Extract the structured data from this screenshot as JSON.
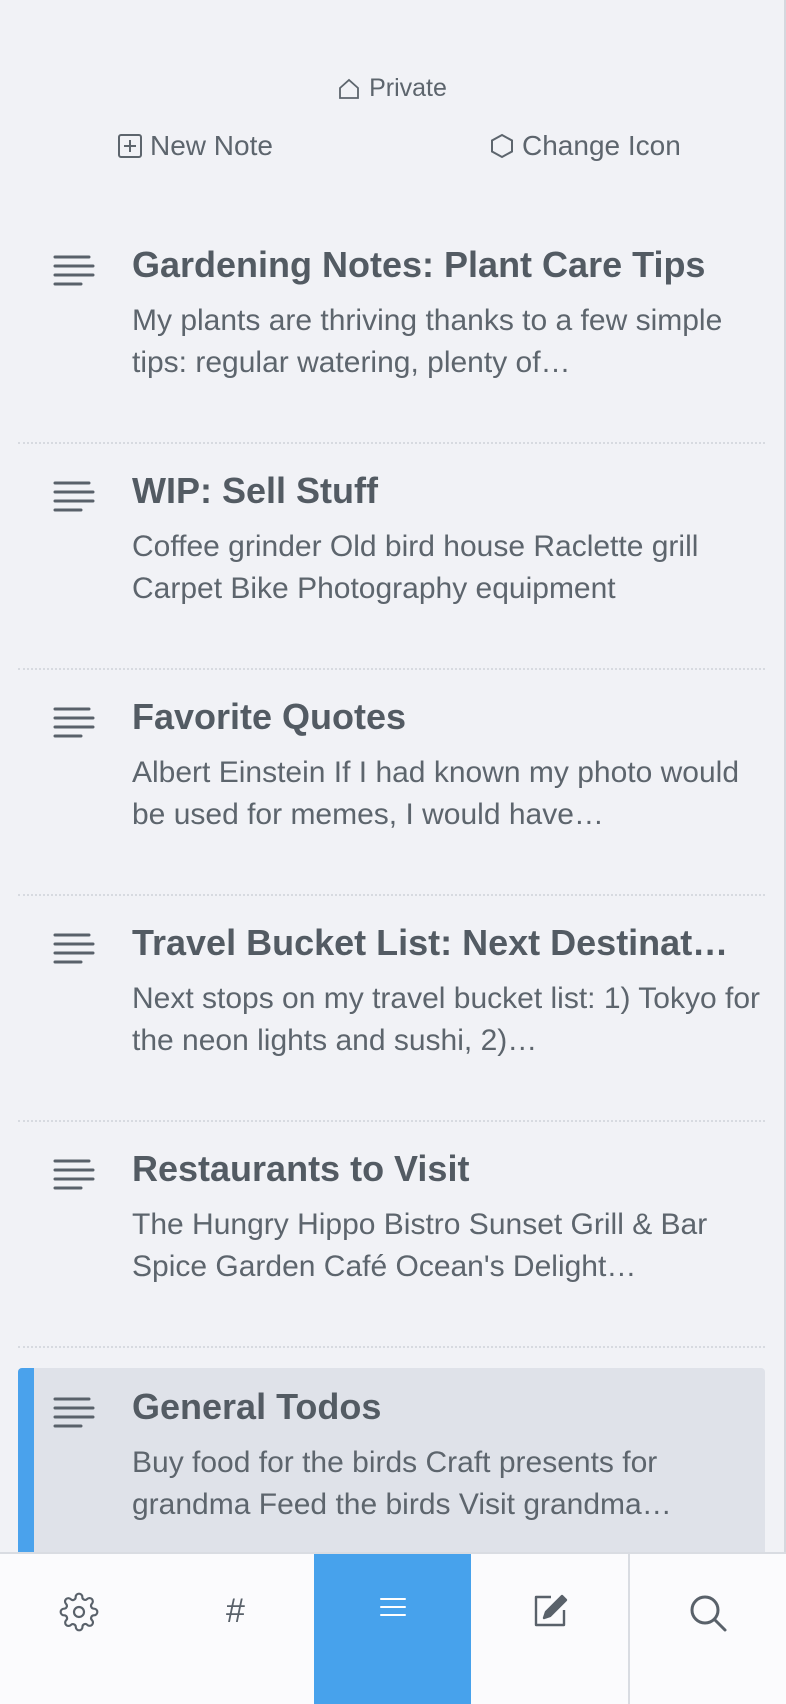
{
  "header": {
    "location_label": "Private",
    "location_icon": "home-icon",
    "new_note_label": "New Note",
    "new_note_icon": "plus-square-icon",
    "change_icon_label": "Change Icon",
    "change_icon_icon": "hexagon-icon"
  },
  "notes": [
    {
      "title": "Gardening Notes: Plant Care Tips",
      "preview": "My plants are thriving thanks to a few simple tips: regular watering, plenty of…"
    },
    {
      "title": "WIP: Sell Stuff",
      "preview": "Coffee grinder Old bird house Raclette grill Carpet Bike Photography equipment"
    },
    {
      "title": "Favorite Quotes",
      "preview": "Albert Einstein If I had known my photo would be used for memes, I would have…"
    },
    {
      "title": "Travel Bucket List: Next Destinat…",
      "preview": "Next stops on my travel bucket list: 1) Tokyo for the neon lights and sushi, 2)…"
    },
    {
      "title": "Restaurants to Visit",
      "preview": "The Hungry Hippo Bistro Sunset Grill & Bar Spice Garden Café Ocean's Delight…"
    },
    {
      "title": "General Todos",
      "preview": "Buy food for the birds Craft presents for grandma Feed the birds Visit grandma…",
      "selected": true
    }
  ],
  "tabbar": {
    "tabs": [
      {
        "name": "settings",
        "icon": "gear-icon"
      },
      {
        "name": "tags",
        "icon": "hash-icon",
        "glyph": "#"
      },
      {
        "name": "notes",
        "icon": "list-icon",
        "active": true
      },
      {
        "name": "edit",
        "icon": "compose-icon"
      },
      {
        "name": "search",
        "icon": "search-icon"
      }
    ]
  },
  "colors": {
    "background": "#f1f2f6",
    "text": "#535b63",
    "accent": "#47a2ec",
    "selected_row": "#dfe2e9"
  }
}
